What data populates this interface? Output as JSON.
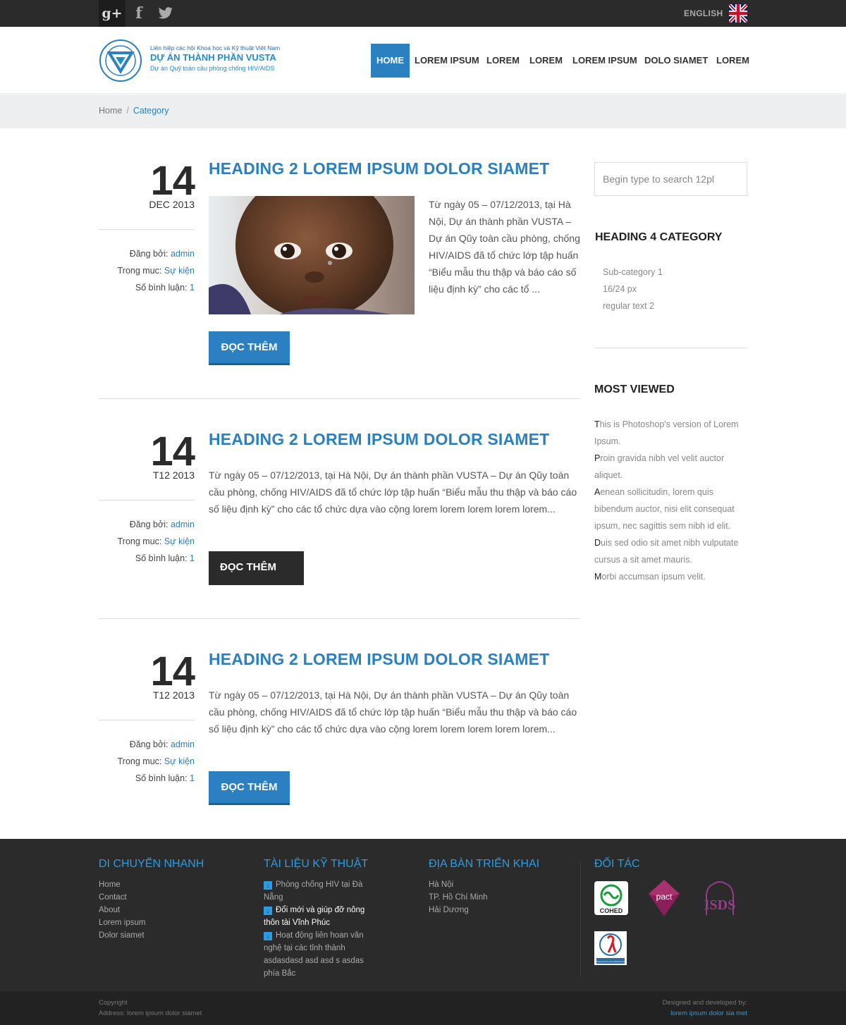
{
  "topbar": {
    "language": "ENGLISH",
    "social": [
      "google-plus",
      "facebook",
      "twitter"
    ]
  },
  "logo": {
    "line1": "Liên hiệp các hội Khoa học và Kỹ thuật Việt Nam",
    "line2": "DỰ ÁN THÀNH PHẦN VUSTA",
    "line3": "Dự án Quỹ toàn cầu phòng chống HIV/AIDS"
  },
  "nav": {
    "items": [
      "HOME",
      "LOREM IPSUM",
      "LOREM",
      "LOREM",
      "LOREM IPSUM",
      "DOLO SIAMET",
      "LOREM"
    ],
    "active_color": "#2a80c1"
  },
  "breadcrumb": {
    "home": "Home",
    "separator": "/",
    "current": "Category"
  },
  "posts": [
    {
      "day": "14",
      "month": "DEC 2013",
      "title": "HEADING 2 LOREM IPSUM DOLOR SIAMET",
      "text": "Từ ngày 05 – 07/12/2013, tại Hà Nội, Dự án thành phần VUSTA – Dự án Qũy toàn cầu phòng, chống HIV/AIDS đã tổ chức lớp tập huấn “Biểu mẫu thu thập và báo cáo số liệu định kỳ” cho các tổ ...",
      "author_label": "Đăng bởi:",
      "author": "admin",
      "category_label": "Trong muc:",
      "category": "Sự kiện",
      "comments_label": "Số bình luận:",
      "comments": "1",
      "button": "ĐỌC THÊM"
    },
    {
      "day": "14",
      "month": "T12 2013",
      "title": "HEADING 2 LOREM IPSUM DOLOR SIAMET",
      "text": "Từ ngày 05 – 07/12/2013, tại Hà Nội, Dự án thành phần VUSTA – Dự án Qũy toàn cầu phòng, chống HIV/AIDS đã tổ chức lớp tập huấn “Biểu mẫu thu thập và báo cáo số liệu định kỳ” cho các tổ chức dựa vào cộng lorem lorem lorem lorem lorem...",
      "author_label": "Đăng bởi:",
      "author": "admin",
      "category_label": "Trong muc:",
      "category": "Sự kiện",
      "comments_label": "Số bình luận:",
      "comments": "1",
      "button": "ĐỌC THÊM"
    },
    {
      "day": "14",
      "month": "T12 2013",
      "title": "HEADING 2 LOREM IPSUM DOLOR SIAMET",
      "text": "Từ ngày 05 – 07/12/2013, tại Hà Nội, Dự án thành phần VUSTA – Dự án Qũy toàn cầu phòng, chống HIV/AIDS đã tổ chức lớp tập huấn “Biểu mẫu thu thập và báo cáo số liệu định kỳ” cho các tổ chức dựa vào cộng lorem lorem lorem lorem lorem...",
      "author_label": "Đăng bởi:",
      "author": "admin",
      "category_label": "Trong muc:",
      "category": "Sự kiện",
      "comments_label": "Số bình luận:",
      "comments": "1",
      "button": "ĐỌC THÊM"
    }
  ],
  "sidebar": {
    "search_placeholder": "Begin type to search 12pl",
    "category_heading": "HEADING 4 CATEGORY",
    "categories": [
      "Sub-category 1",
      "16/24 px",
      "regular text 2"
    ],
    "most_viewed_heading": "MOST VIEWED",
    "most_viewed": [
      {
        "first": "T",
        "rest": "his is Photoshop's version  of Lorem Ipsum."
      },
      {
        "first": "P",
        "rest": "roin gravida nibh vel velit auctor aliquet."
      },
      {
        "first": "A",
        "rest": "enean sollicitudin, lorem quis bibendum auctor, nisi elit consequat ipsum, nec sagittis sem nibh id elit."
      },
      {
        "first": "D",
        "rest": "uis sed odio sit amet nibh vulputate cursus a sit amet mauris."
      },
      {
        "first": "M",
        "rest": "orbi accumsan ipsum velit."
      }
    ]
  },
  "footer": {
    "col1": {
      "heading": "DI CHUYỂN NHANH",
      "items": [
        "Home",
        "Contact",
        "About",
        "Lorem ipsum",
        "Dolor siamet"
      ]
    },
    "col2": {
      "heading": "TÀI LIỆU KỸ THUẬT",
      "items": [
        {
          "text": "Phòng chống HIV tại Đà Nẵng",
          "highlight": false
        },
        {
          "text": "Đổi mới và giúp đỡ nông thôn tài Vĩnh Phúc",
          "highlight": true
        },
        {
          "text": "Hoạt động liên hoan văn nghệ tại các tỉnh thành asdasdasd asd asd s asdas phía Bắc",
          "highlight": false
        }
      ]
    },
    "col3": {
      "heading": "ĐỊA BÀN TRIỂN KHAI",
      "items": [
        "Hà Nội",
        "TP. Hồ Chí Minh",
        "Hải Dương"
      ]
    },
    "col4": {
      "heading": "ĐỐI TÁC",
      "partners": [
        "COHED",
        "pact",
        "ISDS",
        "Supported by the Global Fund"
      ]
    },
    "copyright": "Copyright",
    "address": "Address: lorem ipsum dolor siamet",
    "designed_label": "Designed and developed by:",
    "designed_by": "lorem ipsum dolor sia met"
  }
}
